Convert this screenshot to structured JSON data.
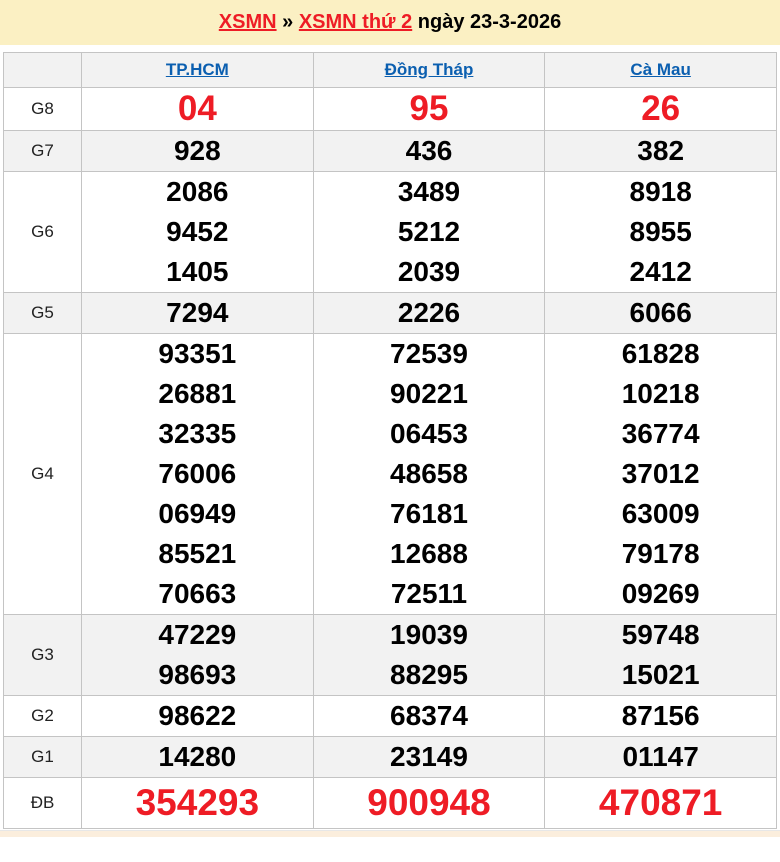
{
  "title": {
    "link1": "XSMN",
    "separator": " » ",
    "link2": "XSMN thứ 2",
    "date_text": " ngày 23-3-2026"
  },
  "table": {
    "columns": [
      "TP.HCM",
      "Đồng Tháp",
      "Cà Mau"
    ],
    "rows": [
      {
        "label": "G8",
        "emphasis": true,
        "values": [
          [
            "04"
          ],
          [
            "95"
          ],
          [
            "26"
          ]
        ]
      },
      {
        "label": "G7",
        "emphasis": false,
        "values": [
          [
            "928"
          ],
          [
            "436"
          ],
          [
            "382"
          ]
        ]
      },
      {
        "label": "G6",
        "emphasis": false,
        "values": [
          [
            "2086",
            "9452",
            "1405"
          ],
          [
            "3489",
            "5212",
            "2039"
          ],
          [
            "8918",
            "8955",
            "2412"
          ]
        ]
      },
      {
        "label": "G5",
        "emphasis": false,
        "values": [
          [
            "7294"
          ],
          [
            "2226"
          ],
          [
            "6066"
          ]
        ]
      },
      {
        "label": "G4",
        "emphasis": false,
        "values": [
          [
            "93351",
            "26881",
            "32335",
            "76006",
            "06949",
            "85521",
            "70663"
          ],
          [
            "72539",
            "90221",
            "06453",
            "48658",
            "76181",
            "12688",
            "72511"
          ],
          [
            "61828",
            "10218",
            "36774",
            "37012",
            "63009",
            "79178",
            "09269"
          ]
        ]
      },
      {
        "label": "G3",
        "emphasis": false,
        "values": [
          [
            "47229",
            "98693"
          ],
          [
            "19039",
            "88295"
          ],
          [
            "59748",
            "15021"
          ]
        ]
      },
      {
        "label": "G2",
        "emphasis": false,
        "values": [
          [
            "98622"
          ],
          [
            "68374"
          ],
          [
            "87156"
          ]
        ]
      },
      {
        "label": "G1",
        "emphasis": false,
        "values": [
          [
            "14280"
          ],
          [
            "23149"
          ],
          [
            "01147"
          ]
        ]
      },
      {
        "label": "ĐB",
        "emphasis": true,
        "values": [
          [
            "354293"
          ],
          [
            "900948"
          ],
          [
            "470871"
          ]
        ]
      }
    ]
  },
  "colors": {
    "title_background": "#fbf0c3",
    "accent_red": "#ee1c25",
    "link_blue": "#0b5fb0",
    "alt_row_gray": "#f2f2f2",
    "border_gray": "#c4c4c4"
  }
}
